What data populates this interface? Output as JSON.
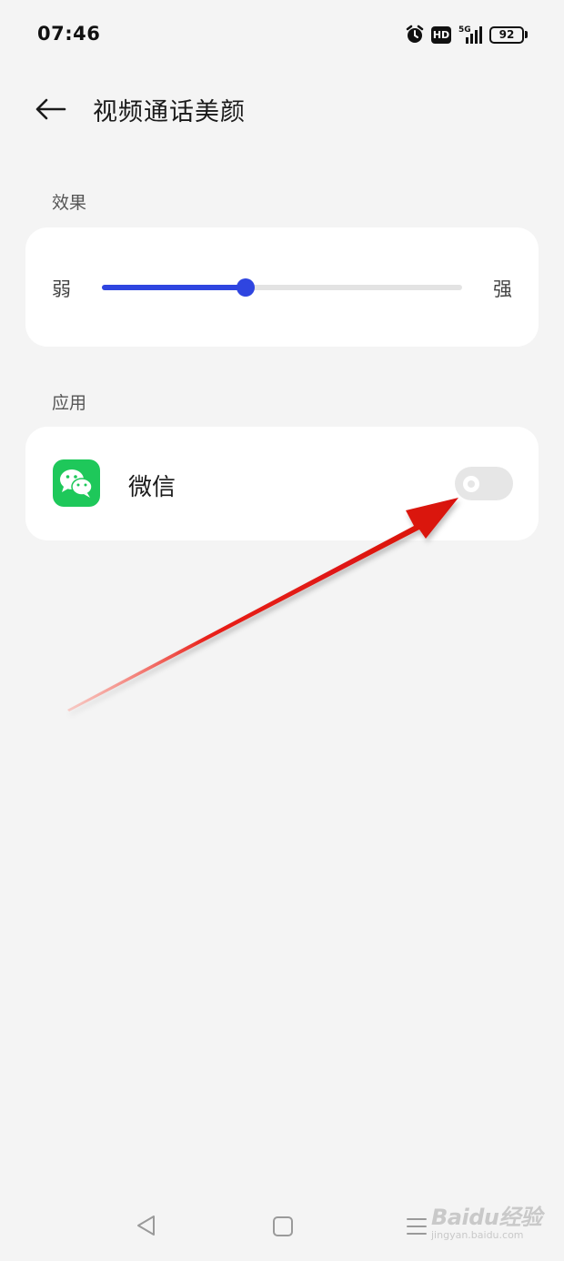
{
  "status_bar": {
    "time": "07:46",
    "network_label": "5G",
    "hd_label": "HD",
    "battery_level": "92",
    "icons": [
      "alarm-icon",
      "hd-icon",
      "signal-5g-icon",
      "battery-icon"
    ]
  },
  "header": {
    "title": "视频通话美颜",
    "back_icon": "arrow-left-icon"
  },
  "effect_section": {
    "label": "效果",
    "slider": {
      "min_label": "弱",
      "max_label": "强",
      "value": 0.4,
      "accent_color": "#2f45e0"
    }
  },
  "apps_section": {
    "label": "应用",
    "items": [
      {
        "name": "微信",
        "icon": "wechat-icon",
        "icon_color": "#1ec85a",
        "enabled": false
      }
    ]
  },
  "annotation": {
    "arrow_color": "#e8201a",
    "target": "toggle"
  },
  "nav_bar": {
    "buttons": [
      "nav-back-icon",
      "nav-home-icon",
      "nav-recents-icon"
    ]
  },
  "watermark": {
    "text": "Baidu经验",
    "url": "jingyan.baidu.com"
  }
}
